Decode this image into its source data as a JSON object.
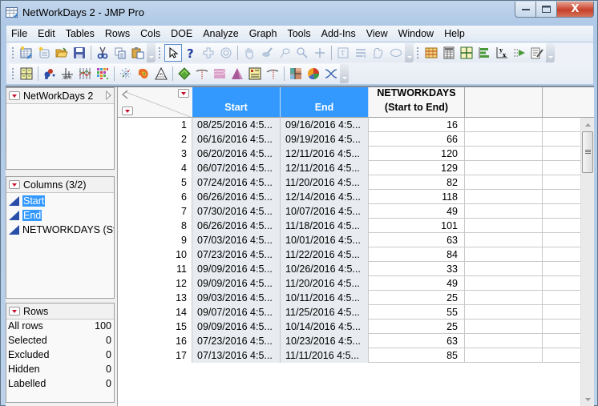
{
  "window": {
    "title": "NetWorkDays 2 - JMP Pro",
    "controls": {
      "minimize": "—",
      "maximize": "□",
      "close": "X"
    }
  },
  "menu": [
    "File",
    "Edit",
    "Tables",
    "Rows",
    "Cols",
    "DOE",
    "Analyze",
    "Graph",
    "Tools",
    "Add-Ins",
    "View",
    "Window",
    "Help"
  ],
  "toolbars": {
    "row1": [
      [
        "new-data-table-icon",
        "new-script-icon",
        "open-folder-icon",
        "save-icon",
        "|",
        "cut-icon",
        "copy-icon",
        "paste-icon"
      ],
      [
        "arrow-tool-icon",
        "help-tool-icon",
        "crosshair-tool-icon",
        "target-tool-icon",
        "|",
        "hand-tool-icon",
        "brush-tool-icon",
        "lasso-tool-icon",
        "magnifier-tool-icon",
        "plus-tool-icon",
        "|",
        "annotate-tool-icon",
        "line-tool-icon",
        "polygon-tool-icon",
        "oval-tool-icon"
      ],
      [
        "data-table-icon",
        "calculator-icon",
        "grid-icon",
        "bar-list-icon",
        "formula-yx-icon",
        "arrow-list-icon",
        "edit-script-icon"
      ]
    ],
    "row2": [
      [
        "layout-grid-icon",
        "|",
        "scatter-icon",
        "crosshair-plot-icon",
        "parallel-plot-icon",
        "cell-plot-icon",
        "|",
        "scatter-burst-icon",
        "contour-icon",
        "ternary-icon",
        "|",
        "diamond-icon",
        "profiler-icon",
        "surface-icon",
        "triangle-icon",
        "checklist-icon",
        "profiler2-icon",
        "|",
        "treemap-icon",
        "pie-chart-icon",
        "cross-curve-icon"
      ]
    ]
  },
  "panels": {
    "table": {
      "name": "NetWorkDays 2"
    },
    "columns": {
      "header": "Columns (3/2)",
      "items": [
        {
          "name": "Start",
          "selected": true
        },
        {
          "name": "End",
          "selected": true
        },
        {
          "name": "NETWORKDAYS (St",
          "selected": false
        }
      ]
    },
    "rows": {
      "header": "Rows",
      "stats": [
        {
          "label": "All rows",
          "value": "100"
        },
        {
          "label": "Selected",
          "value": "0"
        },
        {
          "label": "Excluded",
          "value": "0"
        },
        {
          "label": "Hidden",
          "value": "0"
        },
        {
          "label": "Labelled",
          "value": "0"
        }
      ]
    }
  },
  "grid": {
    "columns": [
      {
        "name": "Start",
        "selected": true
      },
      {
        "name": "End",
        "selected": true
      },
      {
        "name_line1": "NETWORKDAYS",
        "name_line2": "(Start to End)",
        "selected": false
      }
    ],
    "rows": [
      {
        "n": "1",
        "start": "08/25/2016 4:5...",
        "end": "09/16/2016 4:5...",
        "networkdays": "16"
      },
      {
        "n": "2",
        "start": "06/16/2016 4:5...",
        "end": "09/19/2016 4:5...",
        "networkdays": "66"
      },
      {
        "n": "3",
        "start": "06/20/2016 4:5...",
        "end": "12/11/2016 4:5...",
        "networkdays": "120"
      },
      {
        "n": "4",
        "start": "06/07/2016 4:5...",
        "end": "12/11/2016 4:5...",
        "networkdays": "129"
      },
      {
        "n": "5",
        "start": "07/24/2016 4:5...",
        "end": "11/20/2016 4:5...",
        "networkdays": "82"
      },
      {
        "n": "6",
        "start": "06/26/2016 4:5...",
        "end": "12/14/2016 4:5...",
        "networkdays": "118"
      },
      {
        "n": "7",
        "start": "07/30/2016 4:5...",
        "end": "10/07/2016 4:5...",
        "networkdays": "49"
      },
      {
        "n": "8",
        "start": "06/26/2016 4:5...",
        "end": "11/18/2016 4:5...",
        "networkdays": "101"
      },
      {
        "n": "9",
        "start": "07/03/2016 4:5...",
        "end": "10/01/2016 4:5...",
        "networkdays": "63"
      },
      {
        "n": "10",
        "start": "07/23/2016 4:5...",
        "end": "11/22/2016 4:5...",
        "networkdays": "84"
      },
      {
        "n": "11",
        "start": "09/09/2016 4:5...",
        "end": "10/26/2016 4:5...",
        "networkdays": "33"
      },
      {
        "n": "12",
        "start": "09/09/2016 4:5...",
        "end": "11/20/2016 4:5...",
        "networkdays": "49"
      },
      {
        "n": "13",
        "start": "09/03/2016 4:5...",
        "end": "10/11/2016 4:5...",
        "networkdays": "25"
      },
      {
        "n": "14",
        "start": "09/07/2016 4:5...",
        "end": "11/25/2016 4:5...",
        "networkdays": "55"
      },
      {
        "n": "15",
        "start": "09/09/2016 4:5...",
        "end": "10/14/2016 4:5...",
        "networkdays": "25"
      },
      {
        "n": "16",
        "start": "07/23/2016 4:5...",
        "end": "10/23/2016 4:5...",
        "networkdays": "63"
      },
      {
        "n": "17",
        "start": "07/13/2016 4:5...",
        "end": "11/11/2016 4:5...",
        "networkdays": "85"
      }
    ]
  },
  "colors": {
    "selection": "#3399ff",
    "dropdown_red": "#c8102e",
    "date_cell_bg": "#e8ebef"
  }
}
